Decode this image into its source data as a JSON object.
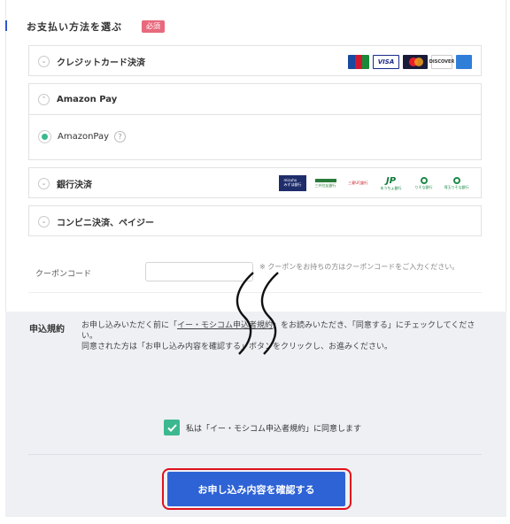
{
  "payment": {
    "section_title": "お支払い方法を選ぶ",
    "required_badge": "必須",
    "credit_card_label": "クレジットカード決済",
    "card_brands": [
      "JCB",
      "VISA",
      "MasterCard",
      "DISCOVER",
      "AMEX"
    ],
    "amazon_pay_label": "Amazon Pay",
    "amazon_pay_option": "AmazonPay",
    "help_symbol": "?",
    "bank_label": "銀行決済",
    "banks": [
      "mizuho",
      "SMBC",
      "MUFG",
      "JP",
      "bank-5",
      "bank-6"
    ],
    "convenience_label": "コンビニ決済、ペイジー"
  },
  "coupon": {
    "label": "クーポンコード",
    "value": "",
    "note": "※ クーポンをお持ちの方はクーポンコードをご入力ください。"
  },
  "terms": {
    "title": "申込規約",
    "line1_pre": "お申し込みいただく前に「",
    "link_text": "イー・モシコム申込者規約",
    "line1_post": "」をお読みいただき、「同意する」にチェックしてください。",
    "line2": "同意された方は「お申し込み内容を確認する」ボタンをクリックし、お進みください。"
  },
  "agree": {
    "label": "私は「イー・モシコム申込者規約」に同意します",
    "checked": true
  },
  "confirm_button": "お申し込み内容を確認する",
  "colors": {
    "accent": "#2e63d6",
    "check_green": "#3cb88f",
    "badge_pink": "#e8697d",
    "highlight_red": "#e0111c"
  }
}
